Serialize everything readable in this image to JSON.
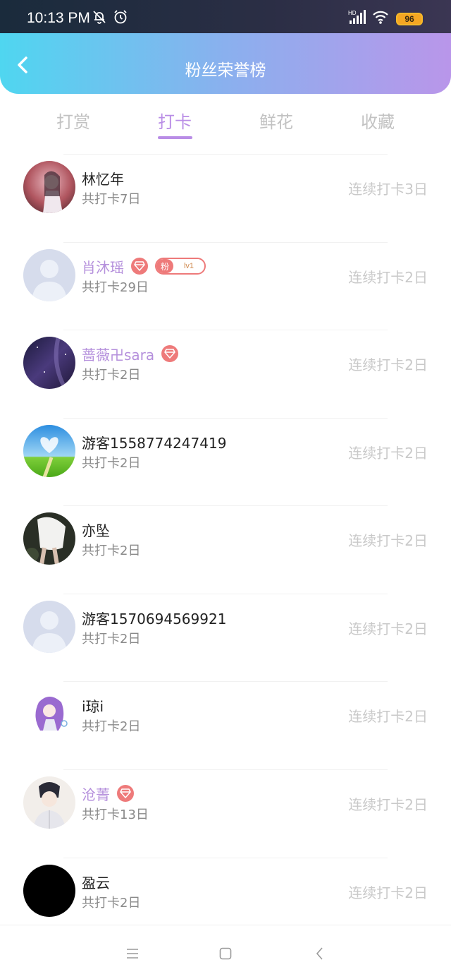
{
  "status_bar": {
    "time": "10:13 PM",
    "battery": "96",
    "icons": [
      "mute-bell-icon",
      "alarm-icon",
      "hd-signal-icon",
      "wifi-icon",
      "battery-icon"
    ]
  },
  "header": {
    "title": "粉丝荣誉榜",
    "back_icon": "chevron-left-icon"
  },
  "tabs": [
    {
      "label": "打赏",
      "active": false
    },
    {
      "label": "打卡",
      "active": true
    },
    {
      "label": "鲜花",
      "active": false
    },
    {
      "label": "收藏",
      "active": false
    }
  ],
  "fans": [
    {
      "name": "林忆年",
      "total": "共打卡7日",
      "streak": "连续打卡3日",
      "vip": false,
      "diamond": false,
      "fan_badge": false
    },
    {
      "name": "肖沐瑶",
      "total": "共打卡29日",
      "streak": "连续打卡2日",
      "vip": true,
      "diamond": true,
      "fan_badge": true,
      "badge_label": "粉",
      "badge_level": "lv1"
    },
    {
      "name": "蔷薇卍sara",
      "total": "共打卡2日",
      "streak": "连续打卡2日",
      "vip": true,
      "diamond": true,
      "fan_badge": false
    },
    {
      "name": "游客1558774247419",
      "total": "共打卡2日",
      "streak": "连续打卡2日",
      "vip": false,
      "diamond": false,
      "fan_badge": false
    },
    {
      "name": "亦坠",
      "total": "共打卡2日",
      "streak": "连续打卡2日",
      "vip": false,
      "diamond": false,
      "fan_badge": false
    },
    {
      "name": "游客1570694569921",
      "total": "共打卡2日",
      "streak": "连续打卡2日",
      "vip": false,
      "diamond": false,
      "fan_badge": false
    },
    {
      "name": "i琼i",
      "total": "共打卡2日",
      "streak": "连续打卡2日",
      "vip": false,
      "diamond": false,
      "fan_badge": false
    },
    {
      "name": "沧菁",
      "total": "共打卡13日",
      "streak": "连续打卡2日",
      "vip": true,
      "diamond": true,
      "fan_badge": false
    },
    {
      "name": "盈云",
      "total": "共打卡2日",
      "streak": "连续打卡2日",
      "vip": false,
      "diamond": false,
      "fan_badge": false
    }
  ],
  "colors": {
    "accent": "#b98de6",
    "vip_name": "#b590dc",
    "diamond": "#ee7a7a",
    "gradient_start": "#4fd6f0",
    "gradient_end": "#b996ea"
  },
  "nav_bar": {
    "icons": [
      "menu-icon",
      "home-square-icon",
      "back-triangle-icon"
    ]
  }
}
